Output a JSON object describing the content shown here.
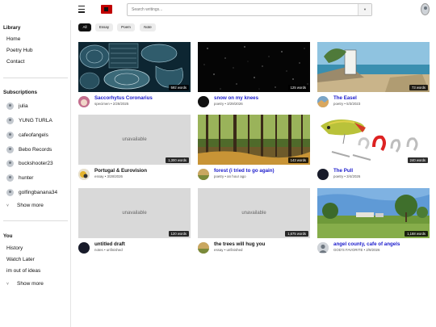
{
  "search": {
    "placeholder": "Search writings..."
  },
  "sidebar": {
    "library_title": "Library",
    "library": [
      "Home",
      "Poetry Hub",
      "Contact"
    ],
    "subscriptions_title": "Subscriptions",
    "subscriptions": [
      "julia",
      "YUNG TURLA",
      "cafeofangels",
      "Bebo Records",
      "buckshooter23",
      "hunter",
      "golfingbanana34"
    ],
    "subs_more": "Show more",
    "you_title": "You",
    "you": [
      "History",
      "Watch Later",
      "im out of ideas"
    ],
    "you_more": "Show more"
  },
  "filters": [
    "All",
    "Essay",
    "Poem",
    "Note"
  ],
  "unavailable_label": "unavailable",
  "cards": [
    {
      "title": "Saccorhytus Coronarius",
      "meta": "specimen • 2/28/2025",
      "words": "592 words",
      "thumb": "sketch",
      "link": true
    },
    {
      "title": "snow on my knees",
      "meta": "poetry • 3/29/2026",
      "words": "125 words",
      "thumb": "night",
      "link": true
    },
    {
      "title": "The Easel",
      "meta": "poetry • 5/3/2023",
      "words": "73 words",
      "thumb": "sea",
      "link": true
    },
    {
      "title": "Portugal & Eurovision",
      "meta": "essay • 3/28/2026",
      "words": "1,300 words",
      "thumb": "unavailable",
      "link": false
    },
    {
      "title": "forest (i tried to go again)",
      "meta": "poetry • an hour ago",
      "words": "143 words",
      "thumb": "forest",
      "link": true
    },
    {
      "title": "The Pull",
      "meta": "poetry • 3/4/2026",
      "words": "240 words",
      "thumb": "lure",
      "link": true
    },
    {
      "title": "untitled draft",
      "meta": "notes • unfinished",
      "words": "120 words",
      "thumb": "unavailable",
      "link": false
    },
    {
      "title": "the trees will hug you",
      "meta": "essay • unfinished",
      "words": "1,675 words",
      "thumb": "unavailable",
      "link": false
    },
    {
      "title": "angel county, cafe of angels",
      "meta": "GOD'S FAVORITE • 2/9/2026",
      "words": "1,168 words",
      "thumb": "park",
      "link": true
    }
  ],
  "colors": {
    "title_link": "#1a1acc",
    "logo": "#c00000"
  },
  "icons": {
    "menu": "hamburger-icon",
    "logo": "site-logo",
    "dropdown": "chevron-down-icon",
    "profile": "profile-avatar"
  }
}
